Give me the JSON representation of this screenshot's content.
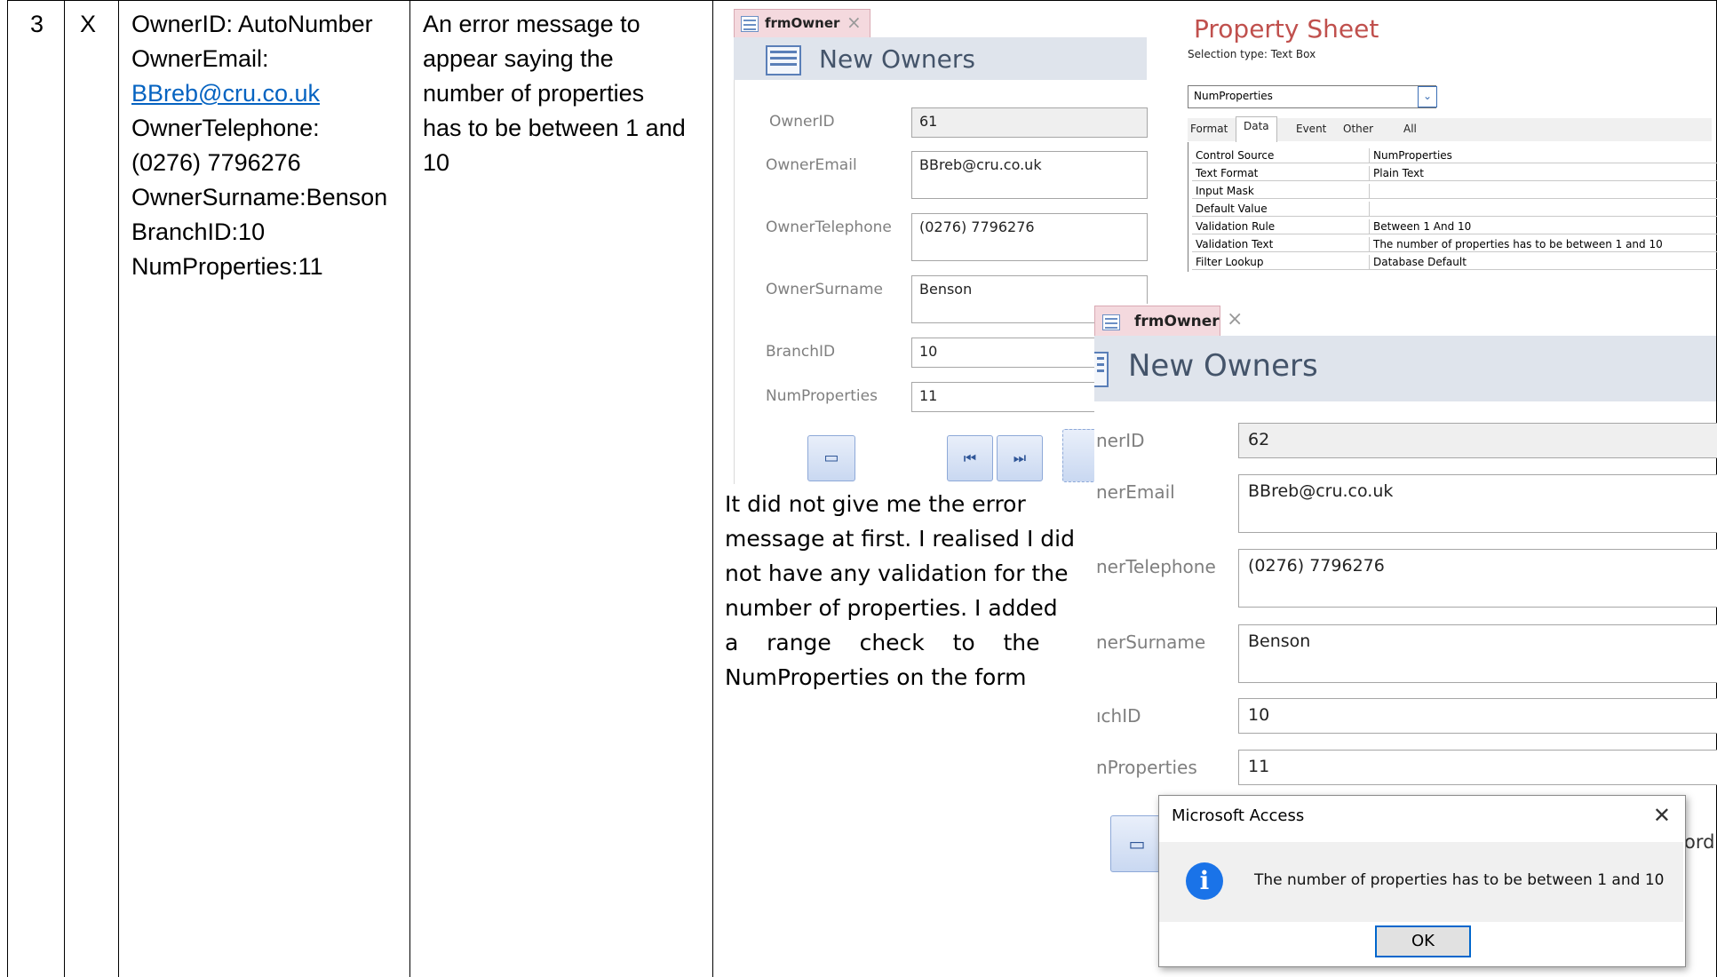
{
  "row": {
    "number": "3",
    "mark": "X",
    "test_data": {
      "line1": "OwnerID: AutoNumber",
      "line2": "OwnerEmail:",
      "email": "BBreb@cru.co.uk",
      "line4": "OwnerTelephone:",
      "line5": "(0276) 7796276",
      "line6": "OwnerSurname:Benson",
      "line7": "BranchID:10",
      "line8": "NumProperties:11"
    },
    "expected": {
      "line1": "An error message to",
      "line2": "appear saying the",
      "line3": "number of properties",
      "line4": "has to be between 1 and",
      "line5": "10"
    },
    "comment": {
      "line1": "It did not give me the error",
      "line2": "message at first. I realised I did",
      "line3": "not have any validation for the",
      "line4": "number of properties. I added",
      "line5": "a    range    check    to    the",
      "line6": "NumProperties on the form"
    }
  },
  "form1": {
    "tab": "frmOwner",
    "title": "New Owners",
    "labels": {
      "id": "OwnerID",
      "email": "OwnerEmail",
      "tel": "OwnerTelephone",
      "surname": "OwnerSurname",
      "branch": "BranchID",
      "num": "NumProperties"
    },
    "values": {
      "id": "61",
      "email": "BBreb@cru.co.uk",
      "tel": "(0276) 7796276",
      "surname": "Benson",
      "branch": "10",
      "num": "11"
    }
  },
  "property_sheet": {
    "title": "Property Sheet",
    "selection": "Selection type:  Text Box",
    "selected": "NumProperties",
    "tabs": [
      "Format",
      "Data",
      "Event",
      "Other",
      "All"
    ],
    "rows": [
      {
        "k": "Control Source",
        "v": "NumProperties"
      },
      {
        "k": "Text Format",
        "v": "Plain Text"
      },
      {
        "k": "Input Mask",
        "v": ""
      },
      {
        "k": "Default Value",
        "v": ""
      },
      {
        "k": "Validation Rule",
        "v": "Between 1 And 10"
      },
      {
        "k": "Validation Text",
        "v": "The number of properties has to be between 1 and 10"
      },
      {
        "k": "Filter Lookup",
        "v": "Database Default"
      }
    ]
  },
  "form2": {
    "tab": "frmOwner",
    "title": "New Owners",
    "labels": {
      "id": "nerID",
      "email": "nerEmail",
      "tel": "nerTelephone",
      "surname": "nerSurname",
      "branch": "ıchID",
      "num": "nProperties"
    },
    "values": {
      "id": "62",
      "email": "BBreb@cru.co.uk",
      "tel": "(0276) 7796276",
      "surname": "Benson",
      "branch": "10",
      "num": "11"
    },
    "partial_button": "ord"
  },
  "dialog": {
    "title": "Microsoft Access",
    "message": "The number of properties has to be between 1 and 10",
    "ok": "OK",
    "info_glyph": "i"
  }
}
